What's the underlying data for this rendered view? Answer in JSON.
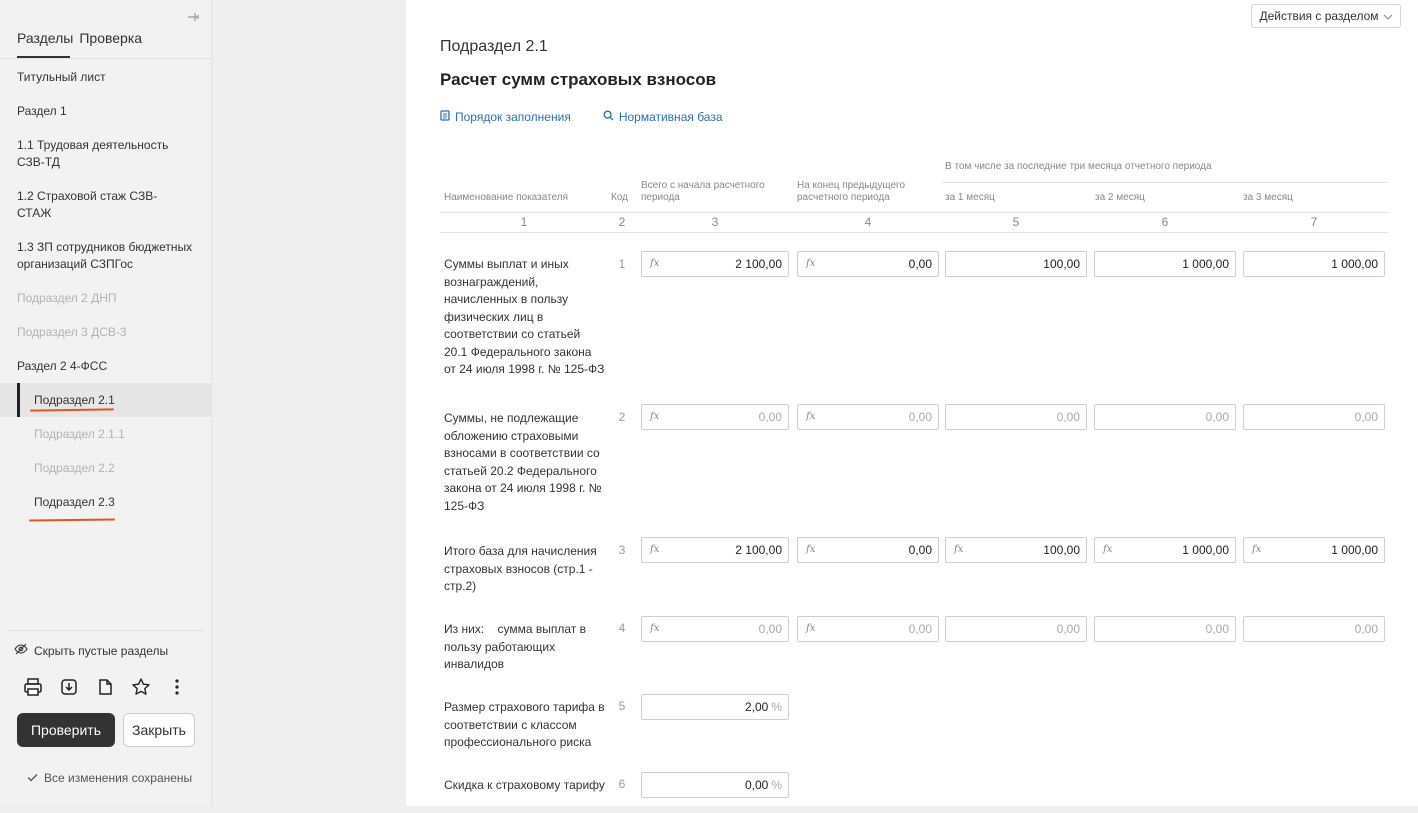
{
  "sidebar": {
    "tabs": [
      "Разделы",
      "Проверка"
    ],
    "items": [
      {
        "label": "Титульный лист"
      },
      {
        "label": "Раздел 1"
      },
      {
        "label": "1.1 Трудовая деятельность СЗВ-ТД"
      },
      {
        "label": "1.2 Страховой стаж СЗВ-СТАЖ"
      },
      {
        "label": "1.3 ЗП сотрудников бюджетных организаций СЗПГос"
      },
      {
        "label": "Подраздел 2 ДНП"
      },
      {
        "label": "Подраздел 3 ДСВ-3"
      },
      {
        "label": "Раздел 2 4-ФСС"
      },
      {
        "label": "Подраздел 2.1"
      },
      {
        "label": "Подраздел 2.1.1"
      },
      {
        "label": "Подраздел 2.2"
      },
      {
        "label": "Подраздел 2.3"
      }
    ],
    "hide_empty_label": "Скрыть пустые разделы",
    "check_button": "Проверить",
    "close_button": "Закрыть",
    "saved_status": "Все изменения сохранены"
  },
  "main": {
    "actions_button": "Действия с разделом",
    "subtitle": "Подраздел 2.1",
    "title": "Расчет сумм страховых взносов",
    "links": {
      "fill_order": "Порядок заполнения",
      "normative_base": "Нормативная база"
    },
    "table": {
      "group_header": "В том числе за последние три месяца отчетного периода",
      "headers": {
        "name": "Наименование показателя",
        "code": "Код",
        "total": "Всего с начала расчетного периода",
        "prev": "На конец предыдущего расчетного периода",
        "m1": "за 1 месяц",
        "m2": "за 2 месяц",
        "m3": "за 3 месяц"
      },
      "col_numbers": [
        "1",
        "2",
        "3",
        "4",
        "5",
        "6",
        "7"
      ],
      "rows": [
        {
          "label": "Суммы выплат и иных вознаграждений, начисленных в пользу физических лиц в соответствии со статьей 20.1 Федерального закона от 24 июля 1998 г. № 125-ФЗ",
          "code": "1",
          "values": [
            "2 100,00",
            "0,00",
            "100,00",
            "1 000,00",
            "1 000,00"
          ]
        },
        {
          "label": "Суммы, не подлежащие обложению страховыми взносами в соответствии со статьей 20.2 Федерального закона от 24 июля 1998 г. № 125-ФЗ",
          "code": "2",
          "values": [
            "0,00",
            "0,00",
            "0,00",
            "0,00",
            "0,00"
          ]
        },
        {
          "label": "Итого база для начисления страховых взносов (стр.1 - стр.2)",
          "code": "3",
          "values": [
            "2 100,00",
            "0,00",
            "100,00",
            "1 000,00",
            "1 000,00"
          ]
        },
        {
          "label": "Из них:    сумма выплат в пользу работающих инвалидов",
          "code": "4",
          "values": [
            "0,00",
            "0,00",
            "0,00",
            "0,00",
            "0,00"
          ]
        },
        {
          "label": "Размер страхового тарифа в соответствии с классом профессионального риска",
          "code": "5",
          "values": [
            "2,00"
          ]
        },
        {
          "label": "Скидка к страховому тарифу",
          "code": "6",
          "values": [
            "0,00"
          ]
        }
      ],
      "percent_sign": "%",
      "fx_symbol": "fx"
    }
  },
  "colors": {
    "accent_link": "#2a6fb5",
    "annotation_underline": "#e3561b",
    "primary_button": "#333333"
  }
}
